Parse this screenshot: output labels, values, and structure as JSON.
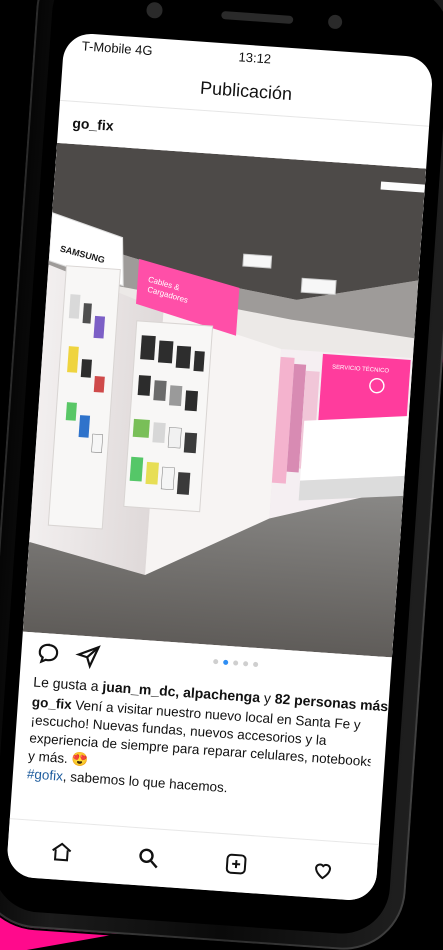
{
  "status_bar": {
    "carrier": "T-Mobile",
    "network": "4G",
    "time": "13:12"
  },
  "page": {
    "title": "Publicación"
  },
  "post": {
    "username": "go_fix",
    "image_text": {
      "brand_sign": "SAMSUNG",
      "wall_sign_line1": "Cables &",
      "wall_sign_line2": "Cargadores",
      "counter_sign": "SERVICIO TÉCNICO"
    },
    "carousel": {
      "total": 5,
      "active_index": 1
    },
    "likes_text": {
      "prefix": "Le gusta a ",
      "names": "juan_m_dc, alpachenga",
      "middle": " y ",
      "count_text": "82 personas más"
    },
    "caption": {
      "username": "go_fix",
      "line1": " Vení a visitar nuestro nuevo local en Santa Fe y",
      "line2": "¡escucho! Nuevas fundas, nuevos accesorios y la",
      "line3": "experiencia de siempre para reparar celulares, notebooks",
      "line4": "y más. 😍",
      "hashtag": "#gofix",
      "line5": ", sabemos lo que hacemos."
    }
  },
  "icons": {
    "comment": "comment-icon",
    "share": "share-icon",
    "home": "home-icon",
    "search": "search-icon",
    "add": "add-post-icon",
    "activity": "heart-icon"
  },
  "colors": {
    "accent": "#ff0a8c",
    "link": "#1f5d9e",
    "active_dot": "#2f8ef4"
  }
}
